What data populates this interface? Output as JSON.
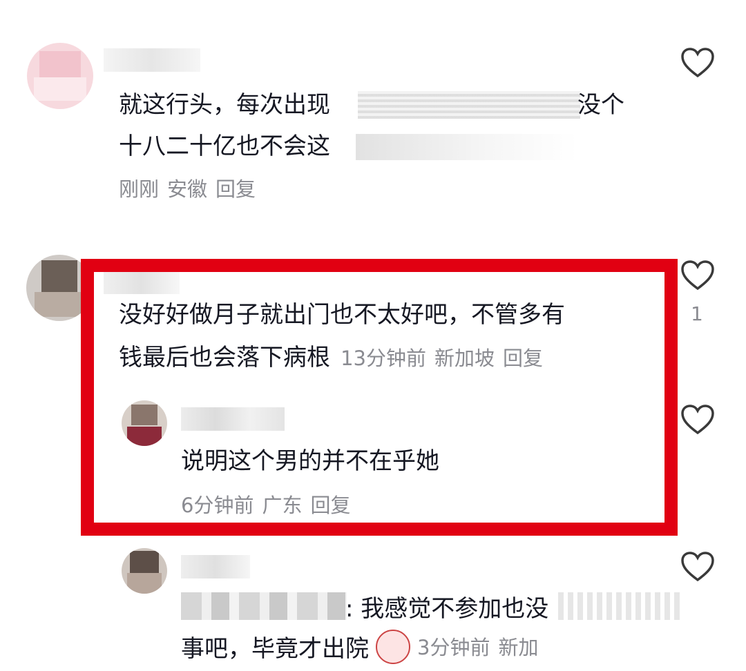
{
  "comments": [
    {
      "lines": [
        "就这行头，每次出现",
        "没个",
        "十八二十亿也不会这"
      ],
      "meta": [
        "刚刚",
        "安徽",
        "回复"
      ]
    },
    {
      "lines": [
        "没好好做月子就出门也不太好吧，不管多有",
        "钱最后也会落下病根"
      ],
      "meta": [
        "13分钟前",
        "新加坡",
        "回复"
      ],
      "likes": "1",
      "reply": {
        "text": "说明这个男的并不在乎她",
        "meta": [
          "6分钟前",
          "广东",
          "回复"
        ]
      }
    },
    {
      "lines": [
        ": 我感觉不参加也没",
        "事吧，毕竟才出院"
      ],
      "meta": [
        "3分钟前",
        "新加"
      ]
    }
  ],
  "colors": {
    "highlight_border": "#e10012",
    "meta_text": "#8a8b91",
    "body_text": "#161823"
  },
  "icons": [
    "heart-outline-icon"
  ]
}
